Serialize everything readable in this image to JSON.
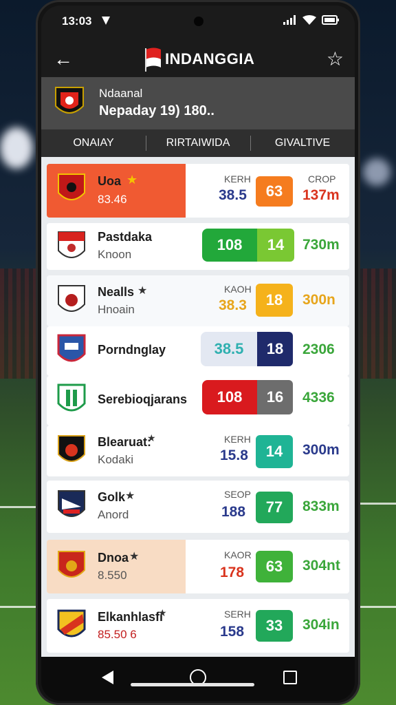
{
  "status_bar": {
    "time": "13:03"
  },
  "app_bar": {
    "title": "INDANGGIA"
  },
  "match_header": {
    "line1": "Ndaanal",
    "line2": "Nepaday 19) 180.."
  },
  "tabs": [
    "ONAIAY",
    "RIRTAIWIDA",
    "GIVALTIVE"
  ],
  "rows": [
    {
      "name": "Uoa",
      "star": "★",
      "sub": "83.46",
      "label1": "KERH",
      "value1": "38.5",
      "pill": "63",
      "label2": "CROP",
      "value2": "137m"
    },
    {
      "name": "Pastdaka",
      "star": "",
      "sub": "Knoon",
      "label1": "",
      "value1": "",
      "pill_left": "108",
      "pill": "14",
      "label2": "",
      "value2": "730m"
    },
    {
      "name": "Nealls",
      "star": "★",
      "sub": "Hnoain",
      "label1": "KAOH",
      "value1": "38.3",
      "pill": "18",
      "label2": "",
      "value2": "300n"
    },
    {
      "name": "Porndnglay",
      "star": "",
      "sub": "",
      "label1": "",
      "value1": "",
      "pill_left": "38.5",
      "pill": "18",
      "label2": "",
      "value2": "2306"
    },
    {
      "name": "Serebioqjarans",
      "star": "",
      "sub": "",
      "label1": "",
      "value1": "",
      "pill_left": "108",
      "pill": "16",
      "label2": "",
      "value2": "4336"
    },
    {
      "name": "Blearuat:",
      "star": "★",
      "sub": "Kodaki",
      "label1": "KERH",
      "value1": "15.8",
      "pill": "14",
      "label2": "",
      "value2": "300m"
    },
    {
      "name": "Golk",
      "star": "★",
      "sub": "Anord",
      "label1": "SEOP",
      "value1": "188",
      "pill": "77",
      "label2": "",
      "value2": "833m"
    },
    {
      "name": "Dnoa",
      "star": "★",
      "sub": "8.550",
      "label1": "KAOR",
      "value1": "178",
      "pill": "63",
      "label2": "",
      "value2": "304nt"
    },
    {
      "name": "Elkanhlasfi",
      "star": "★",
      "sub": "85.50 6",
      "label1": "SERH",
      "value1": "158",
      "pill": "33",
      "label2": "",
      "value2": "304in"
    }
  ],
  "colors": {
    "accent_orange": "#f05a32",
    "pill_orange": "#f57c1f",
    "green_dark": "#22a83a",
    "green_light": "#7ac833",
    "yellow": "#f5b21b",
    "navy": "#1f2a6b",
    "red": "#d91a1e",
    "grey": "#6d6d6d",
    "teal": "#1fb495"
  },
  "icons": {
    "back": "arrow-left-icon",
    "favorite": "star-outline-icon",
    "wifi": "wifi-icon",
    "signal": "signal-icon",
    "battery": "battery-icon"
  }
}
